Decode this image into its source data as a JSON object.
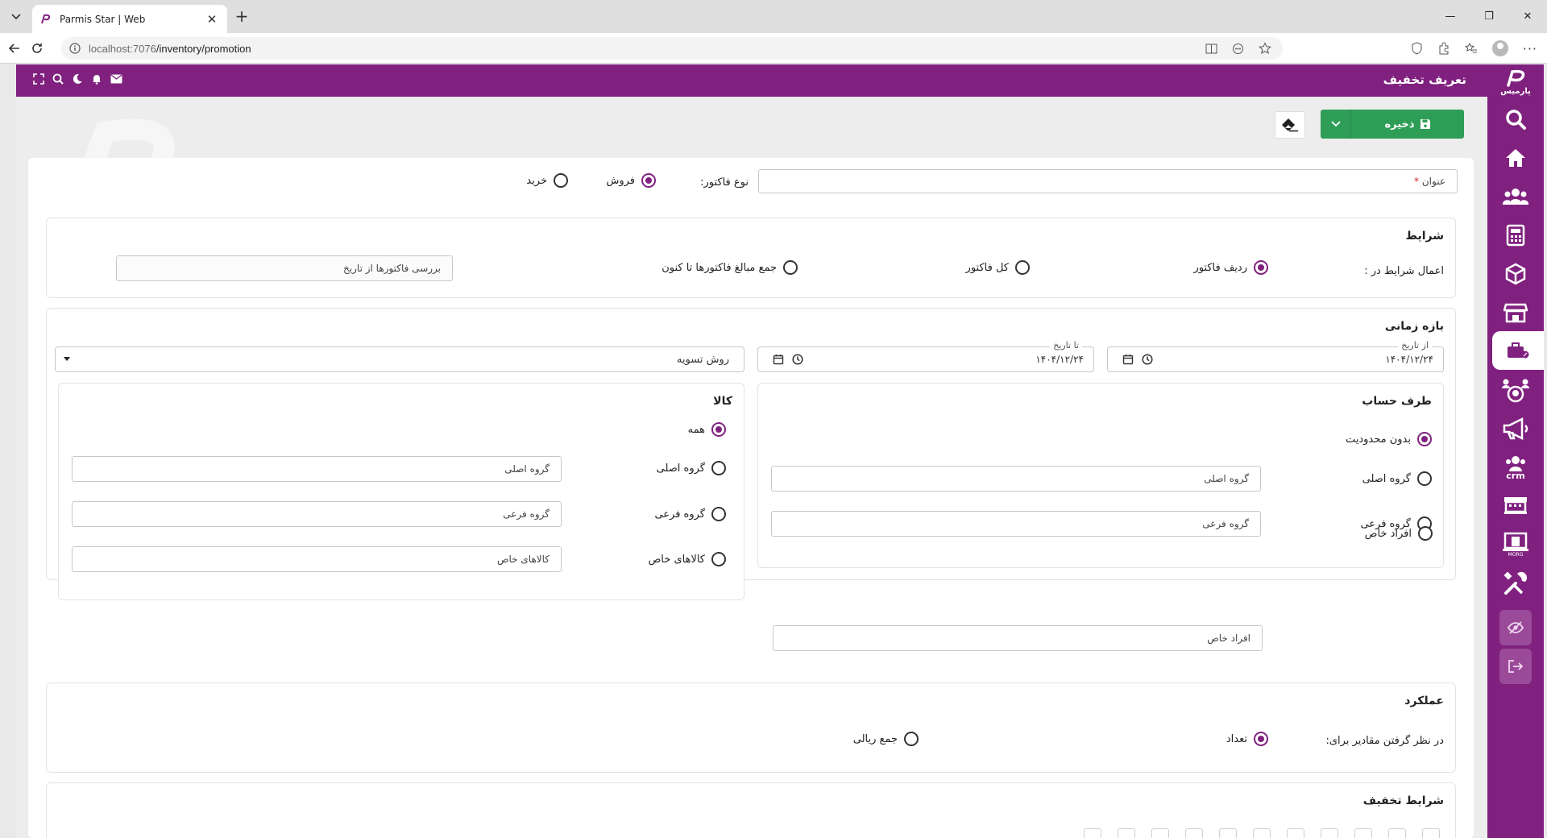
{
  "browser": {
    "tab_title": "Parmis Star | Web",
    "url_host": "localhost:7076",
    "url_path": "/inventory/promotion",
    "minimize": "—",
    "restore": "❐",
    "close": "✕"
  },
  "app": {
    "page_title": "تعریف تخفیف",
    "logo_text": "پارمیس",
    "accent_color": "#80217f",
    "save_color": "#2e9e57"
  },
  "toolbar": {
    "save_label": "ذخیره"
  },
  "sidebar": {
    "crm_label": "crm",
    "morg_label": "MORG"
  },
  "form": {
    "title_label": "عنوان",
    "required_mark": "*",
    "invoice_type_label": "نوع فاکتور:",
    "invoice_types": [
      {
        "label": "فروش",
        "checked": true
      },
      {
        "label": "خرید",
        "checked": false
      }
    ]
  },
  "conditions": {
    "title": "شرایط",
    "apply_label": "اعمال شرایط در :",
    "options": [
      {
        "label": "ردیف فاکتور",
        "checked": true
      },
      {
        "label": "کل فاکتور",
        "checked": false
      },
      {
        "label": "جمع مبالغ فاکتورها تا کنون",
        "checked": false
      }
    ],
    "check_from_date": "بررسی فاکتورها از تاریخ"
  },
  "period": {
    "title": "بازه زمانی",
    "from_caption": "از تاریخ",
    "from_value": "۱۴۰۴/۱۲/۲۴",
    "to_caption": "تا تاریخ",
    "to_value": "۱۴۰۴/۱۲/۲۴",
    "settlement_placeholder": "روش تسویه"
  },
  "account_side": {
    "title": "طرف حساب",
    "options": [
      {
        "label": "بدون محدودیت",
        "checked": true
      },
      {
        "label": "گروه اصلی",
        "checked": false,
        "field": "گروه اصلی"
      },
      {
        "label": "گروه فرعی",
        "checked": false,
        "field": "گروه فرعی"
      },
      {
        "label": "افراد خاص",
        "checked": false,
        "field": "افراد خاص"
      }
    ]
  },
  "goods": {
    "title": "کالا",
    "options": [
      {
        "label": "همه",
        "checked": true
      },
      {
        "label": "گروه اصلی",
        "checked": false,
        "field": "گروه اصلی"
      },
      {
        "label": "گروه فرعی",
        "checked": false,
        "field": "گروه فرعی"
      },
      {
        "label": "کالاهای خاص",
        "checked": false,
        "field": "کالاهای خاص"
      }
    ]
  },
  "performance": {
    "title": "عملکرد",
    "consider_label": "در نظر گرفتن مقادیر برای:",
    "options": [
      {
        "label": "تعداد",
        "checked": true
      },
      {
        "label": "جمع ریالی",
        "checked": false
      }
    ]
  },
  "discount_conditions": {
    "title": "شرایط تخفیف"
  }
}
